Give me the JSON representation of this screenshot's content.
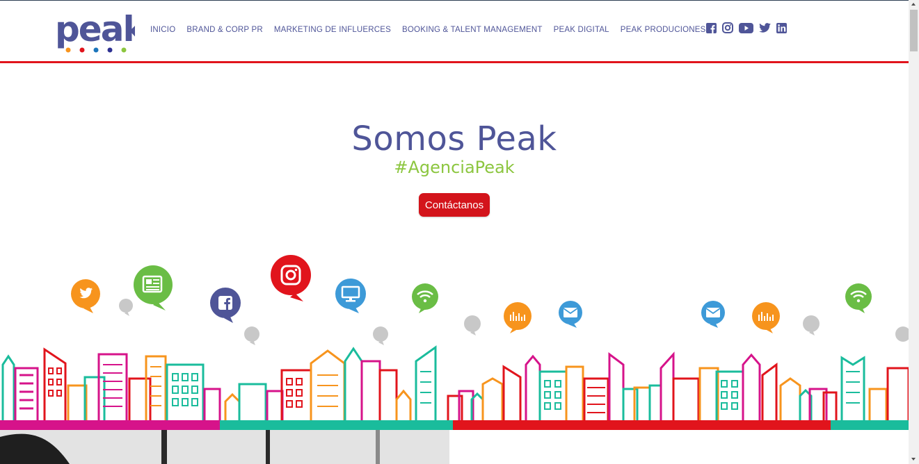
{
  "brand": {
    "logo_text": "peak",
    "dot_colors": [
      "#f7941d",
      "#e1141c",
      "#1b75bb",
      "#2e3192",
      "#8cc63f"
    ]
  },
  "nav": [
    {
      "label": "INICIO"
    },
    {
      "label": "BRAND & CORP PR"
    },
    {
      "label": "MARKETING DE INFLUERCES"
    },
    {
      "label": "BOOKING & TALENT MANAGEMENT"
    },
    {
      "label": "PEAK DIGITAL"
    },
    {
      "label": "PEAK PRODUCIONES"
    }
  ],
  "social": [
    "facebook-icon",
    "instagram-icon",
    "youtube-icon",
    "twitter-icon",
    "linkedin-icon"
  ],
  "hero": {
    "title": "Somos Peak",
    "hashtag": "#AgenciaPeak",
    "cta_label": "Contáctanos"
  },
  "colors": {
    "accent_blue": "#4f5598",
    "green": "#8cc63f",
    "red": "#e1141c",
    "orange": "#f7941d",
    "teal": "#1abc9c",
    "magenta": "#d6138a"
  }
}
